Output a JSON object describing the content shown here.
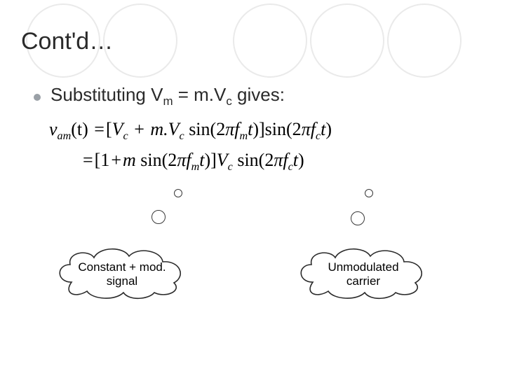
{
  "title": "Cont'd…",
  "bullet": {
    "pre": "Substituting V",
    "sub1": "m",
    "mid": " = m.V",
    "sub2": "c",
    "post": " gives:"
  },
  "eq1": {
    "lhs_v": "v",
    "lhs_sub": "am",
    "lhs_t": "(t)",
    "Vc1": "V",
    "Vc1_sub": "c",
    "mVc": "m.V",
    "mVc_sub": "c",
    "fm": "f",
    "fm_sub": "m",
    "fc": "f",
    "fc_sub": "c",
    "t": "t"
  },
  "eq2": {
    "Vc": "V",
    "Vc_sub": "c",
    "fm": "f",
    "fm_sub": "m",
    "fc": "f",
    "fc_sub": "c",
    "m": "m",
    "t": "t"
  },
  "callouts": {
    "left_l1": "Constant + mod.",
    "left_l2": "signal",
    "right_l1": "Unmodulated",
    "right_l2": "carrier"
  }
}
